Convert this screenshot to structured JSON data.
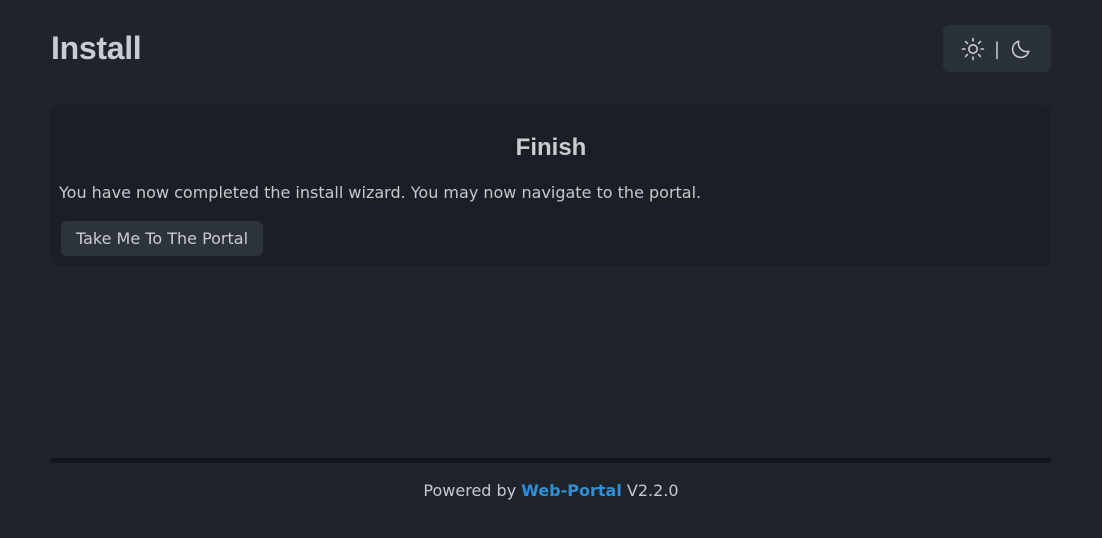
{
  "header": {
    "title": "Install"
  },
  "theme_toggle": {
    "light_icon": "sun-icon",
    "separator": "|",
    "dark_icon": "moon-icon"
  },
  "card": {
    "title": "Finish",
    "message": "You have now completed the install wizard. You may now navigate to the portal.",
    "button_label": "Take Me To The Portal"
  },
  "footer": {
    "prefix": "Powered by",
    "link_text": "Web-Portal",
    "version": "V2.2.0"
  },
  "colors": {
    "background": "#1f242c",
    "card_background": "#1b1f25",
    "button_background": "#2c333d",
    "link": "#2f8fd6",
    "text": "#c5c9ce"
  }
}
